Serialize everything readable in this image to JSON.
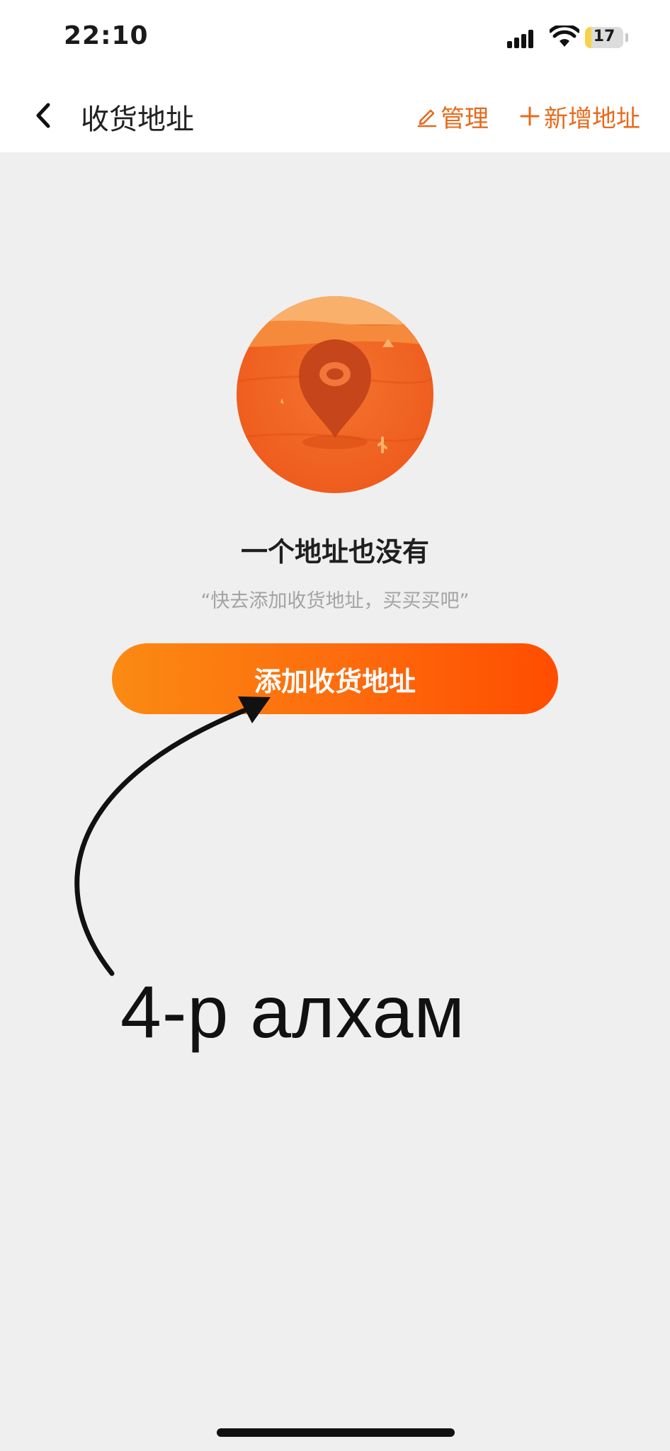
{
  "status_bar": {
    "time": "22:10",
    "battery_level": "17",
    "battery_fraction": 0.17,
    "icons": [
      "signal-icon",
      "wifi-icon",
      "battery-icon"
    ]
  },
  "nav": {
    "back_icon": "chevron-left-icon",
    "title": "收货地址",
    "manage_icon": "pencil-icon",
    "manage_label": "管理",
    "add_icon": "plus-icon",
    "add_label": "新增地址"
  },
  "empty_state": {
    "illustration": "location-pin-desert-illustration",
    "title": "一个地址也没有",
    "subtitle": "“快去添加收货地址，买买买吧”",
    "button_label": "添加收货地址"
  },
  "annotation": {
    "text": "4-р алхам"
  },
  "colors": {
    "accent": "#e86a1c",
    "button_gradient_start": "#fb8a12",
    "button_gradient_end": "#ff4d00",
    "background": "#efefef"
  }
}
